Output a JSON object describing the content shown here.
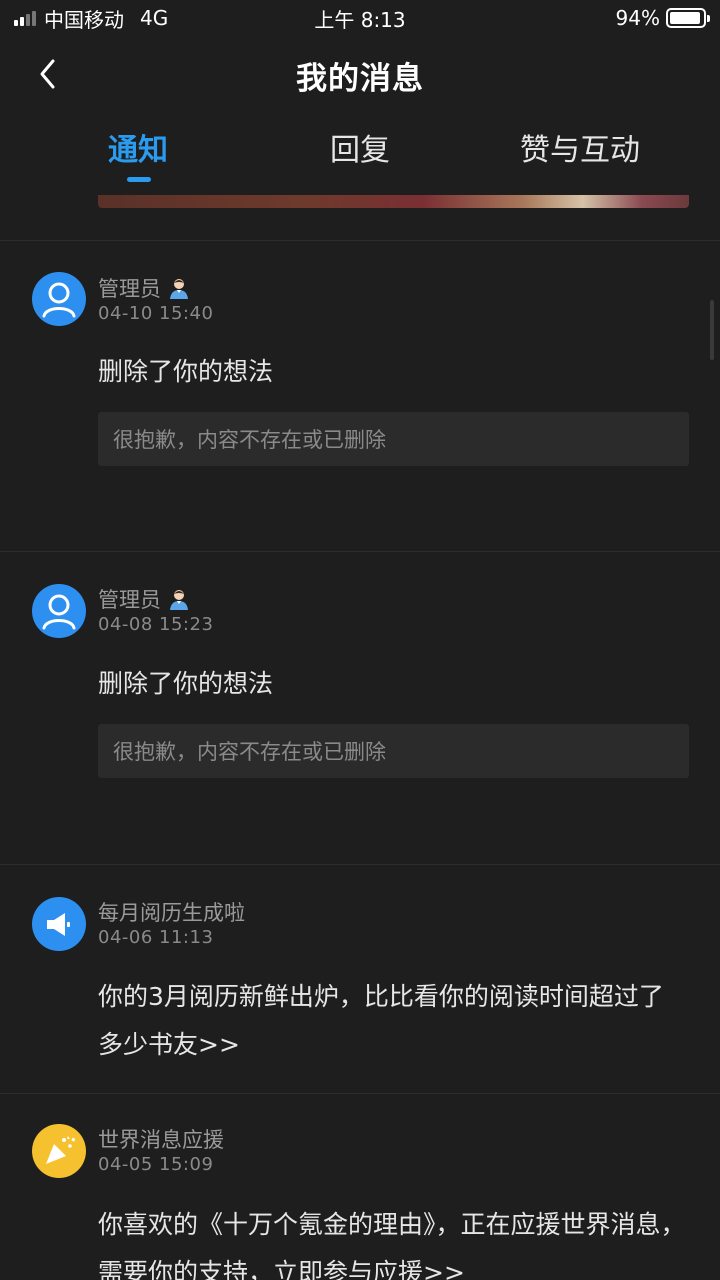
{
  "status_bar": {
    "carrier": "中国移动",
    "network": "4G",
    "time": "上午 8:13",
    "battery": "94%",
    "battery_level": 0.94
  },
  "nav": {
    "back_icon": "chevron-left-icon",
    "title": "我的消息"
  },
  "tabs": [
    {
      "label": "通知",
      "active": true
    },
    {
      "label": "回复",
      "active": false
    },
    {
      "label": "赞与互动",
      "active": false
    }
  ],
  "colors": {
    "accent": "#2b9bef",
    "avatar_blue": "#2d8ff0",
    "avatar_yellow": "#f5c12e",
    "background": "#1e1e1e"
  },
  "messages": [
    {
      "sender": "管理员",
      "avatar_icon": "user-icon",
      "badge_icon": "admin-badge-icon",
      "time": "04-10 15:40",
      "text": "删除了你的想法",
      "quote": "很抱歉，内容不存在或已删除"
    },
    {
      "sender": "管理员",
      "avatar_icon": "user-icon",
      "badge_icon": "admin-badge-icon",
      "time": "04-08 15:23",
      "text": "删除了你的想法",
      "quote": "很抱歉，内容不存在或已删除"
    },
    {
      "sender": "每月阅历生成啦",
      "avatar_icon": "megaphone-icon",
      "time": "04-06 11:13",
      "text": "你的3月阅历新鲜出炉，比比看你的阅读时间超过了多少书友>>"
    },
    {
      "sender": "世界消息应援",
      "avatar_icon": "party-popper-icon",
      "time": "04-05 15:09",
      "text": "你喜欢的《十万个氪金的理由》，正在应援世界消息，需要你的支持，立即参与应援>>"
    }
  ]
}
